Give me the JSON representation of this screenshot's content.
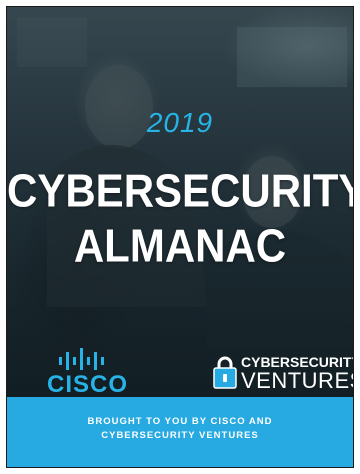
{
  "cover": {
    "year": "2019",
    "title_line_1": "CYBERSECURITY",
    "title_line_2": "ALMANAC"
  },
  "logos": {
    "cisco": {
      "wordmark": "CISCO"
    },
    "cybersecurity_ventures": {
      "line_1": "CYBERSECURITY",
      "line_2": "VENTURES"
    }
  },
  "footer": {
    "line_1": "BROUGHT TO YOU BY CISCO AND",
    "line_2": "CYBERSECURITY VENTURES"
  },
  "colors": {
    "accent_blue": "#27a9e1",
    "text_white": "#ffffff",
    "photo_dark": "#283841"
  },
  "icons": {
    "cisco": "cisco-bridge-bars-icon",
    "ventures": "padlock-icon"
  }
}
